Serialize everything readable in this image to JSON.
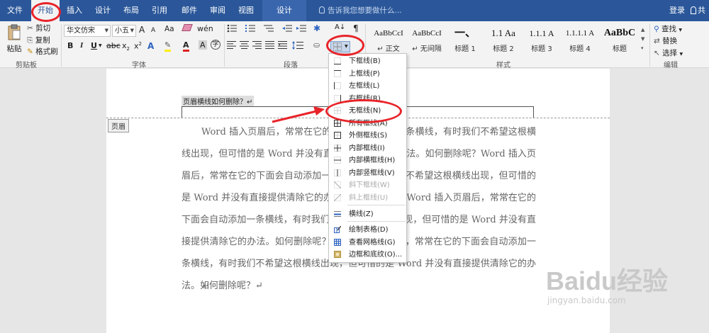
{
  "tabs": [
    {
      "label": "文件"
    },
    {
      "label": "开始"
    },
    {
      "label": "插入"
    },
    {
      "label": "设计"
    },
    {
      "label": "布局"
    },
    {
      "label": "引用"
    },
    {
      "label": "邮件"
    },
    {
      "label": "审阅"
    },
    {
      "label": "视图"
    },
    {
      "label": "设计"
    }
  ],
  "tell_me": "告诉我您想要做什么...",
  "login": "登录",
  "share": "共",
  "clipboard": {
    "paste": "粘贴",
    "cut": "剪切",
    "copy": "复制",
    "format_painter": "格式刷",
    "label": "剪贴板"
  },
  "font": {
    "name": "华文仿宋",
    "size": "小五",
    "grow": "A",
    "shrink": "A",
    "change_case": "Aa",
    "label": "字体"
  },
  "paragraph": {
    "label": "段落"
  },
  "styles": {
    "label": "样式",
    "items": [
      {
        "sample": "AaBbCcI",
        "name": "↵ 正文"
      },
      {
        "sample": "AaBbCcI",
        "name": "↵ 无间隔"
      },
      {
        "sample": "一、",
        "name": "标题 1"
      },
      {
        "sample": "1.1  Aa",
        "name": "标题 2"
      },
      {
        "sample": "1.1.1  A",
        "name": "标题 3"
      },
      {
        "sample": "1.1.1.1  A",
        "name": "标题 4"
      },
      {
        "sample": "AaBbC",
        "name": "标题"
      }
    ]
  },
  "editing": {
    "find": "查找",
    "replace": "替换",
    "select": "选择",
    "label": "编辑"
  },
  "document": {
    "header_text": "页眉横线如何删除？↵",
    "header_tag": "页眉",
    "paragraph": "Word 插入页眉后，常常在它的下面会自动添加一条横线，有时我们不希望这根横线出现，但可惜的是 Word 并没有直接提供清除它的办法。如何删除呢？Word 插入页眉后，常常在它的下面会自动添加一条横线，有时我们不希望这根横线出现，但可惜的是 Word 并没有直接提供清除它的办法。如何删除呢？Word 插入页眉后，常常在它的下面会自动添加一条横线，有时我们不希望这根横线出现，但可惜的是 Word 并没有直接提供清除它的办法。如何删除呢？Word 插入页眉后，常常在它的下面会自动添加一条横线，有时我们不希望这根横线出现，但可惜的是 Word 并没有直接提供清除它的办法。如何删除呢？↵",
    "empty_mark": "↵"
  },
  "border_menu": [
    {
      "label": "下框线(B)",
      "icon": "bottom-border-icon",
      "enabled": true
    },
    {
      "label": "上框线(P)",
      "icon": "top-border-icon",
      "enabled": true
    },
    {
      "label": "左框线(L)",
      "icon": "left-border-icon",
      "enabled": true
    },
    {
      "label": "右框线(R)",
      "icon": "right-border-icon",
      "enabled": true
    },
    {
      "label": "无框线(N)",
      "icon": "no-border-icon",
      "enabled": true
    },
    {
      "label": "所有框线(A)",
      "icon": "all-borders-icon",
      "enabled": true
    },
    {
      "label": "外侧框线(S)",
      "icon": "outside-borders-icon",
      "enabled": true
    },
    {
      "label": "内部框线(I)",
      "icon": "inside-borders-icon",
      "enabled": true
    },
    {
      "label": "内部横框线(H)",
      "icon": "inside-horizontal-border-icon",
      "enabled": true
    },
    {
      "label": "内部竖框线(V)",
      "icon": "inside-vertical-border-icon",
      "enabled": true
    },
    {
      "label": "斜下框线(W)",
      "icon": "diagonal-down-border-icon",
      "enabled": false
    },
    {
      "label": "斜上框线(U)",
      "icon": "diagonal-up-border-icon",
      "enabled": false
    },
    {
      "label": "横线(Z)",
      "icon": "horizontal-line-icon",
      "enabled": true
    },
    {
      "label": "绘制表格(D)",
      "icon": "draw-table-icon",
      "enabled": true
    },
    {
      "label": "查看网格线(G)",
      "icon": "view-gridlines-icon",
      "enabled": true
    },
    {
      "label": "边框和底纹(O)...",
      "icon": "borders-shading-icon",
      "enabled": true
    }
  ],
  "watermark": {
    "brand": "Baidu经验",
    "url": "jingyan.baidu.com"
  },
  "colors": {
    "ribbon_blue": "#2b579a",
    "highlight_red": "#e8242a"
  }
}
